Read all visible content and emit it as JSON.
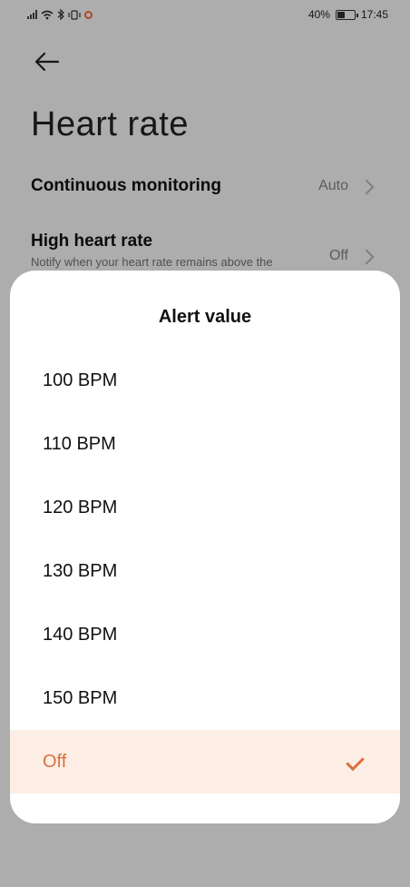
{
  "status_bar": {
    "battery": "40%",
    "time": "17:45"
  },
  "page": {
    "title": "Heart rate",
    "rows": [
      {
        "label": "Continuous monitoring",
        "value": "Auto"
      },
      {
        "label": "High heart rate",
        "subtitle": "Notify when your heart rate remains above the",
        "value": "Off"
      }
    ]
  },
  "sheet": {
    "title": "Alert value",
    "options": [
      "100 BPM",
      "110 BPM",
      "120 BPM",
      "130 BPM",
      "140 BPM",
      "150 BPM",
      "Off"
    ],
    "selected_index": 6,
    "accent": "#d9703f",
    "selected_bg": "#fdeee5"
  }
}
